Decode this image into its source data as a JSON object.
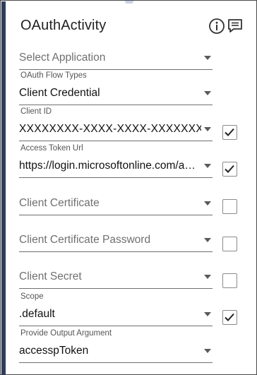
{
  "header": {
    "title": "OAuthActivity",
    "icons": [
      "info-icon",
      "comment-icon"
    ]
  },
  "fields": {
    "application": {
      "placeholder": "Select Application"
    },
    "flow_types": {
      "label": "OAuth Flow Types",
      "value": "Client Credential"
    },
    "client_id": {
      "label": "Client ID",
      "value": "XXXXXXXX-XXXX-XXXX-XXXXXXXX",
      "checked": true
    },
    "access_token_url": {
      "label": "Access Token Url",
      "value": "https://login.microsoftonline.com/a…",
      "checked": true
    },
    "client_certificate": {
      "placeholder": "Client Certificate",
      "checked": false
    },
    "client_certificate_password": {
      "placeholder": "Client Certificate Password",
      "checked": false
    },
    "client_secret": {
      "placeholder": "Client Secret",
      "checked": false
    },
    "scope": {
      "label": "Scope",
      "value": ".default",
      "checked": true
    },
    "output_argument": {
      "label": "Provide Output Argument",
      "value": "accesspToken"
    }
  },
  "colors": {
    "accent_bar": "#2f3d57",
    "underline": "#6f6f6f",
    "checkbox_border": "#8a8a8a"
  }
}
